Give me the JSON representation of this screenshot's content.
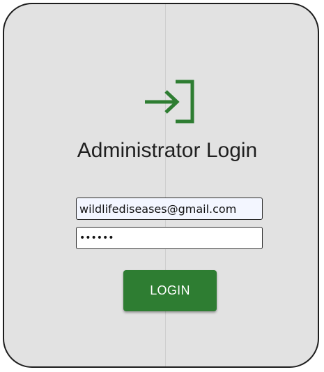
{
  "login": {
    "icon": "login-arrow-icon",
    "title": "Administrator Login",
    "email_value": "wildlifediseases@gmail.com",
    "password_value": "••••••",
    "button_label": "LOGIN"
  },
  "colors": {
    "accent": "#2e7d32",
    "card_background": "#e2e2e2",
    "card_border": "#1e1e1e",
    "title_text": "#1f1f1f"
  }
}
